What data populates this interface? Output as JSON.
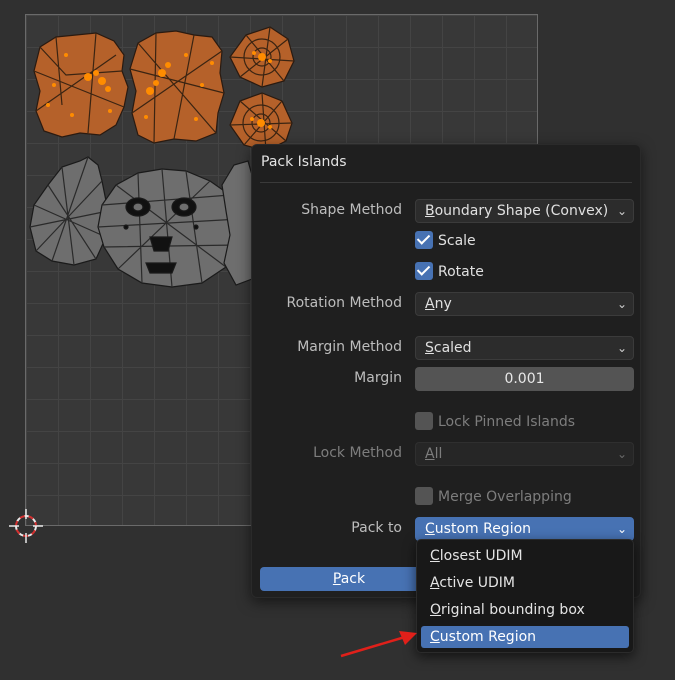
{
  "popup": {
    "title": "Pack Islands",
    "shape_method": {
      "label": "Shape Method",
      "value": "Boundary Shape (Convex)",
      "mnemonic": "B",
      "rest": "oundary Shape (Convex)"
    },
    "scale": {
      "label": "Scale",
      "checked": true
    },
    "rotate": {
      "label": "Rotate",
      "checked": true
    },
    "rotation_method": {
      "label": "Rotation Method",
      "value": "Any",
      "mnemonic": "A",
      "rest": "ny"
    },
    "margin_method": {
      "label": "Margin Method",
      "value": "Scaled",
      "mnemonic": "S",
      "rest": "caled"
    },
    "margin": {
      "label": "Margin",
      "value": "0.001"
    },
    "lock_pinned": {
      "label": "Lock Pinned Islands",
      "checked": false
    },
    "lock_method": {
      "label": "Lock Method",
      "value": "All",
      "mnemonic": "A",
      "rest": "ll"
    },
    "merge_overlapping": {
      "label": "Merge Overlapping",
      "checked": false
    },
    "pack_to": {
      "label": "Pack to",
      "value": "Custom Region",
      "mnemonic": "C",
      "rest": "ustom Region"
    },
    "pack_button": {
      "label": "Pack",
      "mnemonic": "P",
      "rest": "ack"
    }
  },
  "pack_to_menu": {
    "items": [
      {
        "label": "Closest UDIM",
        "mnemonic": "C",
        "rest": "losest UDIM",
        "selected": false
      },
      {
        "label": "Active UDIM",
        "mnemonic": "A",
        "rest": "ctive UDIM",
        "selected": false
      },
      {
        "label": "Original bounding box",
        "mnemonic": "O",
        "rest": "riginal bounding box",
        "selected": false
      },
      {
        "label": "Custom Region",
        "mnemonic": "C",
        "rest": "ustom Region",
        "selected": true
      }
    ]
  },
  "colors": {
    "selected_island_fill": "#b5612a",
    "selected_vertex": "#ff8c00",
    "unselected_island_fill": "#6e6e6e",
    "accent": "#4772b3",
    "annotation_arrow": "#e0201a"
  },
  "icons": {
    "chevron": "chevron-down-icon",
    "cursor": "3d-cursor-icon",
    "arrow": "red-arrow-icon"
  }
}
